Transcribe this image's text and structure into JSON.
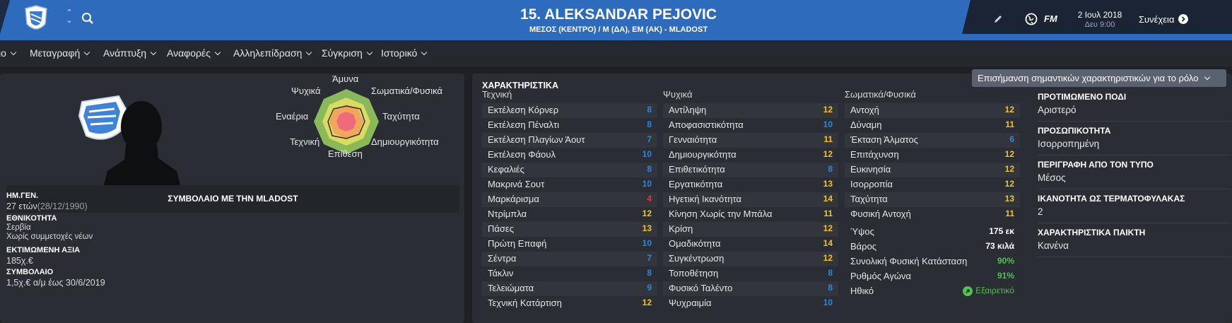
{
  "header": {
    "title": "15. ALEKSANDAR PEJOVIC",
    "subtitle": "ΜΕΣΟΣ (ΚΕΝΤΡΟ) / Μ (ΔΑ), ΕΜ (ΑΚ) - MLADOST",
    "fm_logo": "FM",
    "date": "2 Ιουλ 2018",
    "time": "Δευ 9:00",
    "continue_label": "Συνέχεια",
    "accent_color": "#2e6bbd"
  },
  "menu": [
    {
      "label": "ιο"
    },
    {
      "label": "Μεταγραφή"
    },
    {
      "label": "Ανάπτυξη"
    },
    {
      "label": "Αναφορές"
    },
    {
      "label": "Αλληλεπίδραση"
    },
    {
      "label": "Σύγκριση"
    },
    {
      "label": "Ιστορικό"
    }
  ],
  "radar": {
    "labels": {
      "top": "Άμυνα",
      "top_right": "Σωματικά/Φυσικά",
      "right": "Ταχύτητα",
      "bottom_right": "Δημιουργικότητα",
      "bottom": "Επίθεση",
      "bottom_left": "Τεχνική",
      "left": "Εναέρια",
      "top_left": "Ψυχικά"
    }
  },
  "contract": {
    "title": "ΣΥΜΒΟΛΑΙΟ ΜΕ ΤΗΝ MLADOST"
  },
  "details": {
    "dob_label": "ΗΜ.ΓΕΝ.",
    "age": "27 ετών",
    "dob": "(28/12/1990)",
    "nationality_label": "ΕΘΝΙΚΟΤΗΤΑ",
    "nationality": "Σερβία",
    "youth_caps": "Χωρίς συμμετοχές νέων",
    "value_label": "ΕΚΤΙΜΩΜΕΝΗ ΑΞΙΑ",
    "value": "185χ.€",
    "contract_label": "ΣΥΜΒΟΛΑΙΟ",
    "contract": "1,5χ.€ α/μ έως 30/6/2019"
  },
  "attributes": {
    "title": "ΧΑΡΑΚΤΗΡΙΣΤΙΚΑ",
    "highlight_button": "Επισήμανση σημαντικών χαρακτηριστικών για το ρόλο",
    "colors": {
      "high": "#f3c323",
      "mid": "#2f86e0",
      "low": "#e23a3a"
    },
    "technical": {
      "header": "Τεχνική",
      "rows": [
        {
          "name": "Εκτέλεση Κόρνερ",
          "value": "8",
          "color": "#2f86e0"
        },
        {
          "name": "Εκτέλεση Πέναλτι",
          "value": "8",
          "color": "#2f86e0"
        },
        {
          "name": "Εκτέλεση Πλαγίων Άουτ",
          "value": "7",
          "color": "#2f86e0"
        },
        {
          "name": "Εκτέλεση Φάουλ",
          "value": "10",
          "color": "#2f86e0"
        },
        {
          "name": "Κεφαλιές",
          "value": "8",
          "color": "#2f86e0"
        },
        {
          "name": "Μακρινά Σουτ",
          "value": "10",
          "color": "#2f86e0"
        },
        {
          "name": "Μαρκάρισμα",
          "value": "4",
          "color": "#e23a3a"
        },
        {
          "name": "Ντρίμπλα",
          "value": "12",
          "color": "#f3c323"
        },
        {
          "name": "Πάσες",
          "value": "13",
          "color": "#f3c323"
        },
        {
          "name": "Πρώτη Επαφή",
          "value": "10",
          "color": "#2f86e0"
        },
        {
          "name": "Σέντρα",
          "value": "7",
          "color": "#2f86e0"
        },
        {
          "name": "Τάκλιν",
          "value": "8",
          "color": "#2f86e0"
        },
        {
          "name": "Τελειώματα",
          "value": "9",
          "color": "#2f86e0"
        },
        {
          "name": "Τεχνική Κατάρτιση",
          "value": "12",
          "color": "#f3c323"
        }
      ]
    },
    "mental": {
      "header": "Ψυχικά",
      "rows": [
        {
          "name": "Αντίληψη",
          "value": "12",
          "color": "#f3c323"
        },
        {
          "name": "Αποφασιστικότητα",
          "value": "10",
          "color": "#2f86e0"
        },
        {
          "name": "Γενναιότητα",
          "value": "11",
          "color": "#f3c323"
        },
        {
          "name": "Δημιουργικότητα",
          "value": "12",
          "color": "#f3c323"
        },
        {
          "name": "Επιθετικότητα",
          "value": "8",
          "color": "#2f86e0"
        },
        {
          "name": "Εργατικότητα",
          "value": "13",
          "color": "#f3c323"
        },
        {
          "name": "Ηγετική Ικανότητα",
          "value": "14",
          "color": "#f3c323"
        },
        {
          "name": "Κίνηση Χωρίς την Μπάλα",
          "value": "11",
          "color": "#f3c323"
        },
        {
          "name": "Κρίση",
          "value": "12",
          "color": "#f3c323"
        },
        {
          "name": "Ομαδικότητα",
          "value": "14",
          "color": "#f3c323"
        },
        {
          "name": "Συγκέντρωση",
          "value": "12",
          "color": "#f3c323"
        },
        {
          "name": "Τοποθέτηση",
          "value": "8",
          "color": "#2f86e0"
        },
        {
          "name": "Φυσικό Ταλέντο",
          "value": "8",
          "color": "#2f86e0"
        },
        {
          "name": "Ψυχραιμία",
          "value": "10",
          "color": "#2f86e0"
        }
      ]
    },
    "physical": {
      "header": "Σωματικά/Φυσικά",
      "rows": [
        {
          "name": "Αντοχή",
          "value": "12",
          "color": "#f3c323"
        },
        {
          "name": "Δύναμη",
          "value": "11",
          "color": "#f3c323"
        },
        {
          "name": "Έκταση Άλματος",
          "value": "6",
          "color": "#2f86e0"
        },
        {
          "name": "Επιτάχυνση",
          "value": "12",
          "color": "#f3c323"
        },
        {
          "name": "Ευκινησία",
          "value": "12",
          "color": "#f3c323"
        },
        {
          "name": "Ισορροπία",
          "value": "12",
          "color": "#f3c323"
        },
        {
          "name": "Ταχύτητα",
          "value": "13",
          "color": "#f3c323"
        },
        {
          "name": "Φυσική Αντοχή",
          "value": "11",
          "color": "#f3c323"
        }
      ],
      "extra": [
        {
          "name": "Ύψος",
          "value": "175 εκ",
          "color": "#ffffff"
        },
        {
          "name": "Βάρος",
          "value": "73 κιλά",
          "color": "#ffffff"
        },
        {
          "name": "Συνολική Φυσική Κατάσταση",
          "value": "90%",
          "color": "#4fc24f"
        },
        {
          "name": "Ρυθμός Αγώνα",
          "value": "91%",
          "color": "#4fc24f"
        },
        {
          "name": "Ηθικό",
          "value": "Εξαιρετικό",
          "color": "#4fc24f"
        }
      ]
    }
  },
  "player_info": [
    {
      "label": "ΠΡΟΤΙΜΩΜΕΝΟ ΠΟΔΙ",
      "value": "Αριστερό"
    },
    {
      "label": "ΠΡΟΣΩΠΙΚΟΤΗΤΑ",
      "value": "Ισορροπημένη"
    },
    {
      "label": "ΠΕΡΙΓΡΑΦΗ ΑΠΟ ΤΟΝ ΤΥΠΟ",
      "value": "Μέσος"
    },
    {
      "label": "ΙΚΑΝΟΤΗΤΑ ΩΣ ΤΕΡΜΑΤΟΦΥΛΑΚΑΣ",
      "value": "2"
    },
    {
      "label": "ΧΑΡΑΚΤΗΡΙΣΤΙΚΑ ΠΑΙΚΤΗ",
      "value": "Κανένα"
    }
  ]
}
